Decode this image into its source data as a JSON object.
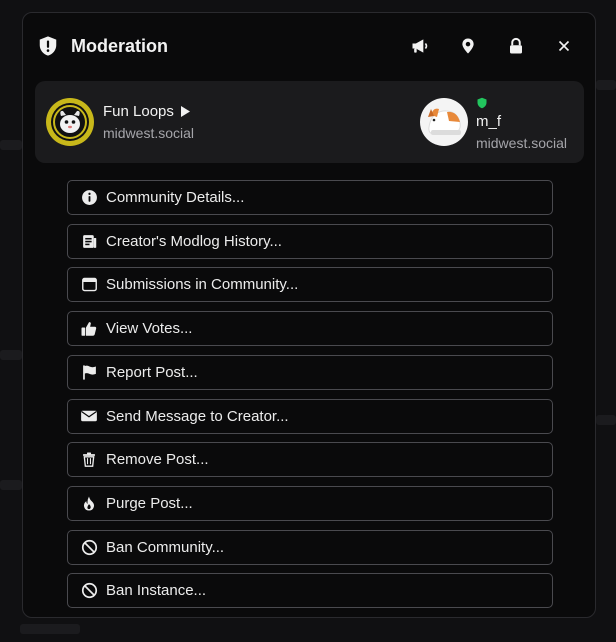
{
  "modal": {
    "title": "Moderation",
    "header_icons": [
      "shield-alert-icon",
      "megaphone-icon",
      "map-pin-icon",
      "lock-icon",
      "close-icon"
    ]
  },
  "community": {
    "name": "Fun Loops",
    "instance": "midwest.social",
    "avatar_icon": "community-avatar"
  },
  "creator": {
    "name": "m_f",
    "instance": "midwest.social",
    "badge_color": "#22c55e"
  },
  "actions": [
    {
      "label": "Community Details...",
      "icon": "info-icon"
    },
    {
      "label": "Creator's Modlog History...",
      "icon": "modlog-icon"
    },
    {
      "label": "Submissions in Community...",
      "icon": "browser-window-icon"
    },
    {
      "label": "View Votes...",
      "icon": "thumbs-up-icon"
    },
    {
      "label": "Report Post...",
      "icon": "flag-icon"
    },
    {
      "label": "Send Message to Creator...",
      "icon": "envelope-icon"
    },
    {
      "label": "Remove Post...",
      "icon": "trash-icon"
    },
    {
      "label": "Purge Post...",
      "icon": "fire-icon"
    },
    {
      "label": "Ban Community...",
      "icon": "ban-icon"
    },
    {
      "label": "Ban Instance...",
      "icon": "ban-icon"
    }
  ]
}
